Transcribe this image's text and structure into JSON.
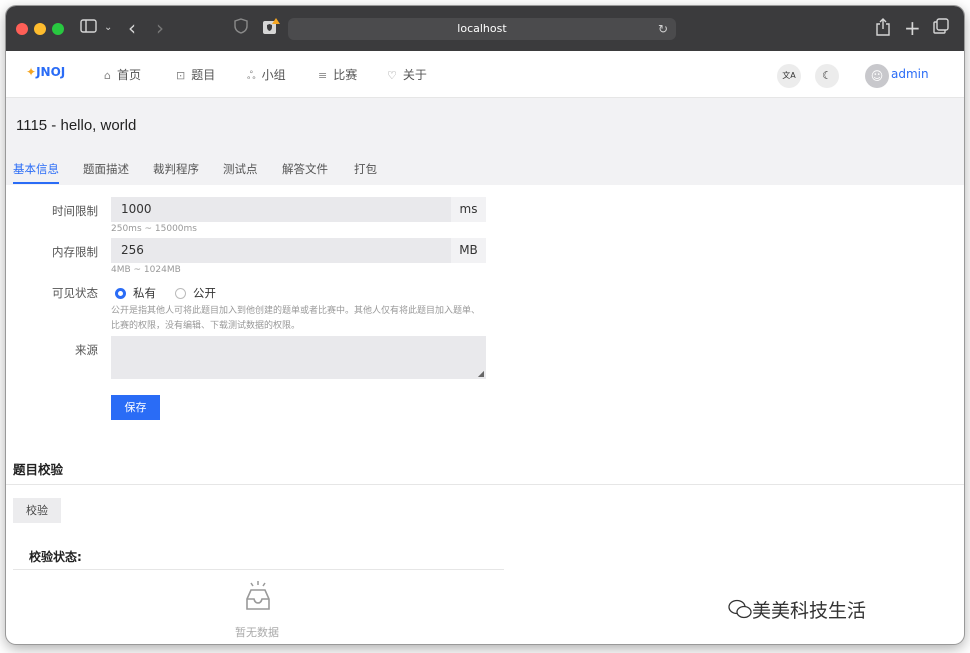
{
  "browser": {
    "url": "localhost",
    "reload_icon": "↻",
    "colors": {
      "close": "#ff5f57",
      "minimize": "#febc2e",
      "zoom": "#28c840"
    }
  },
  "navbar": {
    "logo": "JNOJ",
    "items": [
      {
        "icon": "home-icon",
        "glyph": "⌂",
        "label": "首页"
      },
      {
        "icon": "problem-icon",
        "glyph": "⊡",
        "label": "题目"
      },
      {
        "icon": "group-icon",
        "glyph": "ஃ",
        "label": "小组"
      },
      {
        "icon": "list-icon",
        "glyph": "≡",
        "label": "比赛"
      },
      {
        "icon": "heart-icon",
        "glyph": "♡",
        "label": "关于"
      }
    ],
    "translate_glyph": "文A",
    "theme_glyph": "☾",
    "avatar_glyph": "☺",
    "username": "admin"
  },
  "page": {
    "title": "1115 - hello, world",
    "tabs": [
      "基本信息",
      "题面描述",
      "裁判程序",
      "测试点",
      "解答文件",
      "打包"
    ],
    "active_tab": 0
  },
  "form": {
    "time_limit": {
      "label": "时间限制",
      "value": "1000",
      "unit": "ms",
      "hint": "250ms ~ 15000ms"
    },
    "memory_limit": {
      "label": "内存限制",
      "value": "256",
      "unit": "MB",
      "hint": "4MB ~ 1024MB"
    },
    "visibility": {
      "label": "可见状态",
      "options": [
        "私有",
        "公开"
      ],
      "selected": "私有",
      "description": "公开是指其他人可将此题目加入到他创建的题单或者比赛中。其他人仅有将此题目加入题单、比赛的权限，没有编辑、下载测试数据的权限。"
    },
    "source": {
      "label": "来源",
      "value": ""
    },
    "save_label": "保存"
  },
  "verify": {
    "section_title": "题目校验",
    "button_label": "校验",
    "status_label": "校验状态:",
    "empty_text": "暂无数据"
  },
  "watermark": "美美科技生活"
}
